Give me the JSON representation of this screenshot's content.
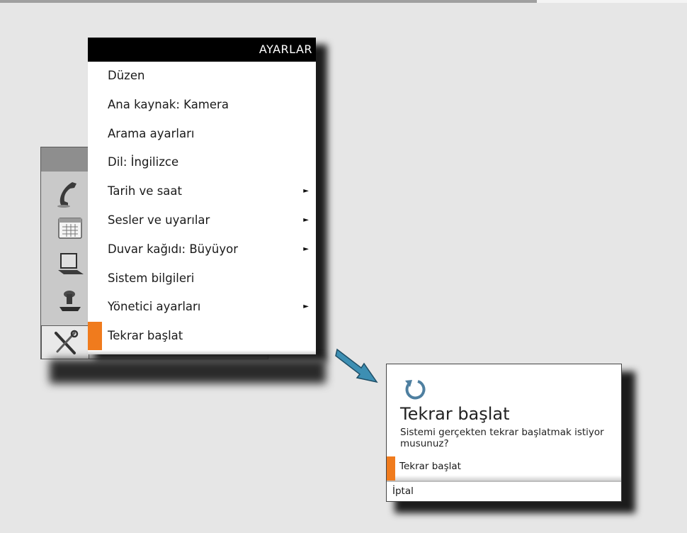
{
  "menu": {
    "title": "AYARLAR",
    "items": [
      {
        "label": "Düzen",
        "submenu": false,
        "selected": false
      },
      {
        "label": "Ana kaynak: Kamera",
        "submenu": false,
        "selected": false
      },
      {
        "label": "Arama ayarları",
        "submenu": false,
        "selected": false
      },
      {
        "label": "Dil: İngilizce",
        "submenu": false,
        "selected": false
      },
      {
        "label": "Tarih ve saat",
        "submenu": true,
        "selected": false
      },
      {
        "label": "Sesler ve uyarılar",
        "submenu": true,
        "selected": false
      },
      {
        "label": "Duvar kağıdı: Büyüyor",
        "submenu": true,
        "selected": false
      },
      {
        "label": "Sistem bilgileri",
        "submenu": false,
        "selected": false
      },
      {
        "label": "Yönetici ayarları",
        "submenu": true,
        "selected": false
      },
      {
        "label": "Tekrar başlat",
        "submenu": false,
        "selected": true
      }
    ],
    "submenu_glyph": "►"
  },
  "rail": {
    "icons": [
      "phone-icon",
      "calendar-icon",
      "laptop-icon",
      "camera-icon",
      "tools-icon"
    ],
    "active": "tools-icon"
  },
  "dialog": {
    "icon": "restart-icon",
    "title": "Tekrar başlat",
    "message": "Sistemi gerçekten tekrar başlatmak istiyor musunuz?",
    "confirm_label": "Tekrar başlat",
    "cancel_label": "İptal"
  },
  "colors": {
    "accent": "#f07b1d",
    "header": "#000000",
    "background": "#e6e6e6"
  }
}
